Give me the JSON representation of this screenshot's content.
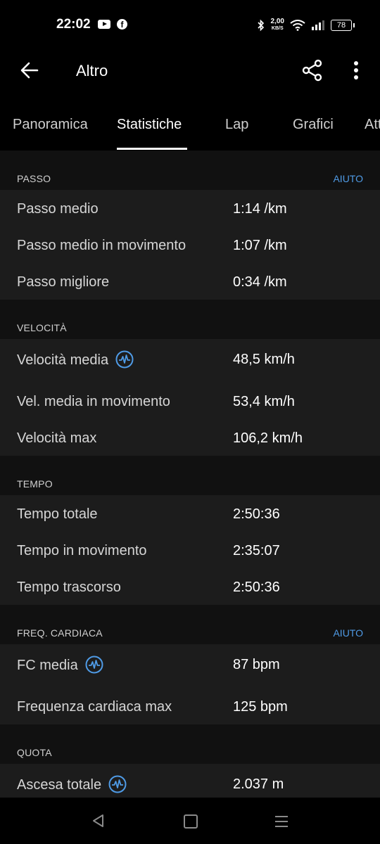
{
  "status_bar": {
    "time": "22:02",
    "net_speed_value": "2,00",
    "net_speed_unit": "KB/S",
    "battery": "78",
    "icons": [
      "youtube-icon",
      "facebook-icon",
      "bluetooth-icon",
      "wifi-icon",
      "signal-icon",
      "battery-icon"
    ]
  },
  "app_bar": {
    "title": "Altro"
  },
  "tabs": [
    {
      "label": "Panoramica"
    },
    {
      "label": "Statistiche",
      "active": true
    },
    {
      "label": "Lap"
    },
    {
      "label": "Grafici"
    },
    {
      "label": "Att"
    }
  ],
  "sections": {
    "passo": {
      "title": "PASSO",
      "help": "AIUTO",
      "rows": [
        {
          "label": "Passo medio",
          "value": "1:14 /km"
        },
        {
          "label": "Passo medio in movimento",
          "value": "1:07 /km"
        },
        {
          "label": "Passo migliore",
          "value": "0:34 /km"
        }
      ]
    },
    "velocita": {
      "title": "VELOCITÀ",
      "rows": [
        {
          "label": "Velocità media",
          "value": "48,5 km/h"
        },
        {
          "label": "Vel. media in movimento",
          "value": "53,4 km/h"
        },
        {
          "label": "Velocità max",
          "value": "106,2 km/h"
        }
      ]
    },
    "tempo": {
      "title": "TEMPO",
      "rows": [
        {
          "label": "Tempo totale",
          "value": "2:50:36"
        },
        {
          "label": "Tempo in movimento",
          "value": "2:35:07"
        },
        {
          "label": "Tempo trascorso",
          "value": "2:50:36"
        }
      ]
    },
    "freq": {
      "title": "FREQ. CARDIACA",
      "help": "AIUTO",
      "rows": [
        {
          "label": "FC media",
          "value": "87 bpm"
        },
        {
          "label": "Frequenza cardiaca max",
          "value": "125 bpm"
        }
      ]
    },
    "quota": {
      "title": "QUOTA",
      "rows": [
        {
          "label": "Ascesa totale",
          "value": "2.037 m"
        }
      ]
    }
  },
  "colors": {
    "accent": "#4f9be6",
    "background": "#000000",
    "section_bg": "#111111",
    "row_bg": "#1c1c1c"
  }
}
